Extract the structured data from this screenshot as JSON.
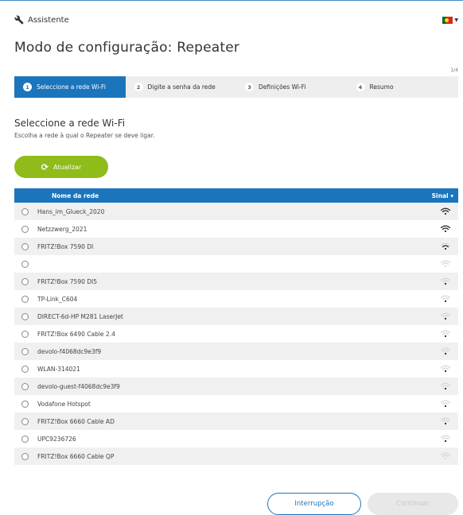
{
  "header": {
    "assistant_label": "Assistente",
    "language_flag_icon": "portugal-flag-icon"
  },
  "page": {
    "title": "Modo de configuração: Repeater"
  },
  "stepper": {
    "counter": "1/4",
    "steps": [
      {
        "number": "1",
        "label": "Seleccione a rede Wi-Fi",
        "active": true
      },
      {
        "number": "2",
        "label": "Digite a senha da rede",
        "active": false
      },
      {
        "number": "3",
        "label": "Definições Wi-Fi",
        "active": false
      },
      {
        "number": "4",
        "label": "Resumo",
        "active": false
      }
    ]
  },
  "section": {
    "title": "Seleccione a rede Wi-Fi",
    "description": "Escolha a rede à qual o Repeater se deve ligar.",
    "refresh_label": "Atualizar"
  },
  "table": {
    "col_name": "Nome da rede",
    "col_signal": "Sinal",
    "rows": [
      {
        "name": "Hans_im_Glueck_2020",
        "signal": 3
      },
      {
        "name": "Netzzwerg_2021",
        "signal": 3
      },
      {
        "name": "FRITZ!Box 7590 DI",
        "signal": 2
      },
      {
        "name": "",
        "signal": 0
      },
      {
        "name": "FRITZ!Box 7590 DI5",
        "signal": 1
      },
      {
        "name": "TP-Link_C604",
        "signal": 1
      },
      {
        "name": "DIRECT-6d-HP M281 LaserJet",
        "signal": 1
      },
      {
        "name": "FRITZ!Box 6490 Cable 2.4",
        "signal": 1
      },
      {
        "name": "devolo-f4068dc9e3f9",
        "signal": 1
      },
      {
        "name": "WLAN-314021",
        "signal": 1
      },
      {
        "name": "devolo-guest-f4068dc9e3f9",
        "signal": 1
      },
      {
        "name": "Vodafone Hotspot",
        "signal": 1
      },
      {
        "name": "FRITZ!Box 6660 Cable AD",
        "signal": 1
      },
      {
        "name": "UPC9236726",
        "signal": 1
      },
      {
        "name": "FRITZ!Box 6660 Cable QP",
        "signal": 0
      }
    ]
  },
  "footer": {
    "cancel_label": "Interrupção",
    "continue_label": "Continuar"
  },
  "colors": {
    "primary": "#1b75bc",
    "accent_green": "#8fbc1a",
    "row_alt": "#f0f0f0"
  }
}
